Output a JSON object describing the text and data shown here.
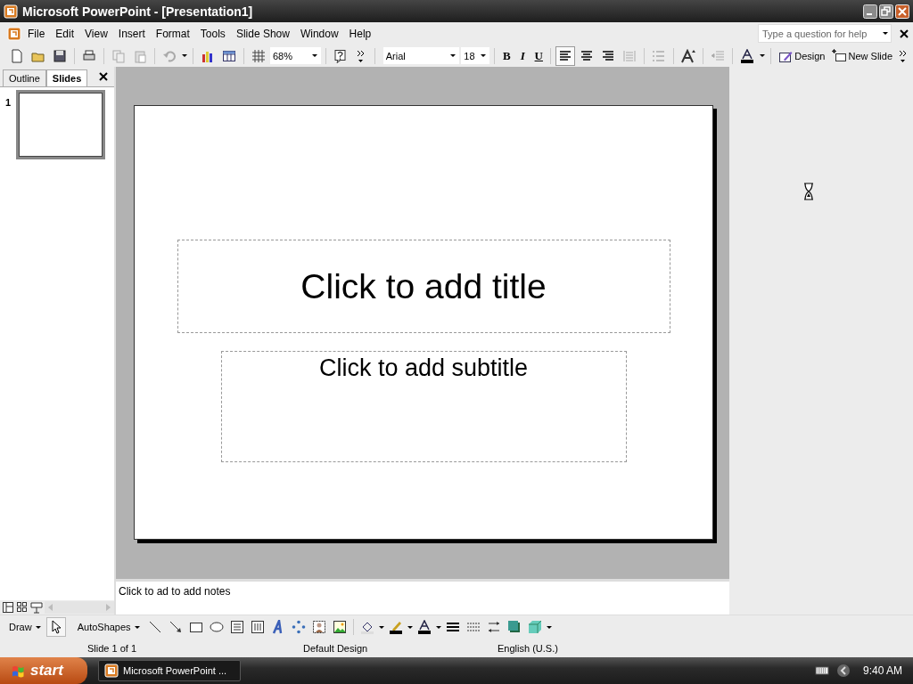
{
  "window": {
    "title": "Microsoft PowerPoint - [Presentation1]"
  },
  "menu": [
    "File",
    "Edit",
    "View",
    "Insert",
    "Format",
    "Tools",
    "Slide Show",
    "Window",
    "Help"
  ],
  "help_box": {
    "placeholder": "Type a question for help"
  },
  "toolbar": {
    "zoom": "68%",
    "font": "Arial",
    "font_size": "18",
    "style_buttons": [
      {
        "label": "B",
        "kind": "bold"
      },
      {
        "label": "I",
        "kind": "italic"
      },
      {
        "label": "U",
        "kind": "underline"
      }
    ],
    "alignment": [
      {
        "kind": "left",
        "selected": true
      },
      {
        "kind": "center",
        "selected": false
      },
      {
        "kind": "right",
        "selected": false
      }
    ],
    "buttons": [
      {
        "label": "Design",
        "kind": "design"
      },
      {
        "label": "New Slide",
        "kind": "new-slide"
      }
    ]
  },
  "pane_tabs": [
    {
      "label": "Outline",
      "selected": false
    },
    {
      "label": "Slides",
      "selected": true
    }
  ],
  "slides": [
    {
      "number": "1",
      "selected": true
    }
  ],
  "slide": {
    "title_placeholder": "Click to add title",
    "subtitle_placeholder": "Click to add subtitle"
  },
  "notes": {
    "value": "Click to ad to add notes"
  },
  "draw_toolbar": {
    "draw": "Draw",
    "autoshapes": "AutoShapes"
  },
  "status_bar": [
    "Slide 1 of 1",
    "Default Design",
    "English (U.S.)"
  ],
  "taskbar": {
    "start": "start",
    "task": "Microsoft PowerPoint ...",
    "clock": "9:40 AM"
  }
}
